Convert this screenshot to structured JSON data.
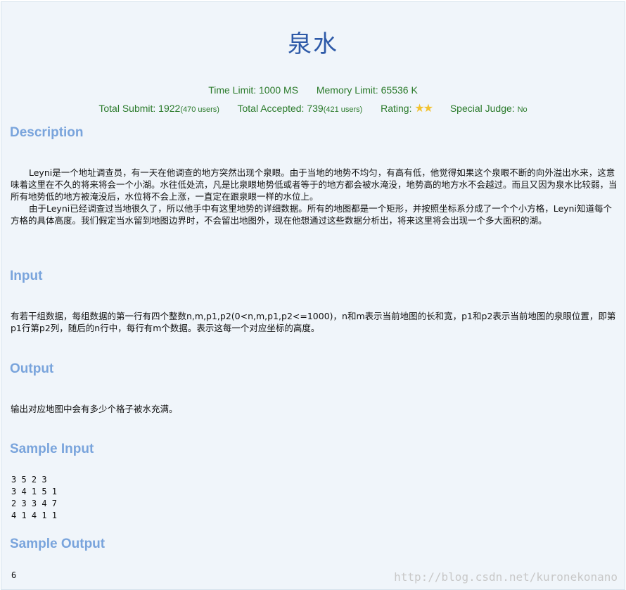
{
  "problem": {
    "title": "泉水",
    "time_limit": "Time Limit: 1000 MS",
    "memory_limit": "Memory Limit: 65536 K",
    "total_submit_label": "Total Submit: 1922",
    "total_submit_users": "(470 users)",
    "total_accepted_label": "Total Accepted: 739",
    "total_accepted_users": "(421 users)",
    "rating_label": "Rating:",
    "rating_stars": "★★",
    "special_judge_label": "Special Judge:",
    "special_judge_value": "No"
  },
  "sections": {
    "description_heading": "Description",
    "description_p1": "Leyni是一个地址调查员，有一天在他调查的地方突然出现个泉眼。由于当地的地势不均匀，有高有低，他觉得如果这个泉眼不断的向外溢出水来，这意味着这里在不久的将来将会一个小湖。水往低处流，凡是比泉眼地势低或者等于的地方都会被水淹没，地势高的地方水不会越过。而且又因为泉水比较弱，当所有地势低的地方被淹没后，水位将不会上涨，一直定在跟泉眼一样的水位上。",
    "description_p2": "由于Leyni已经调查过当地很久了，所以他手中有这里地势的详细数据。所有的地图都是一个矩形，并按照坐标系分成了一个个小方格，Leyni知道每个方格的具体高度。我们假定当水留到地图边界时，不会留出地图外，现在他想通过这些数据分析出，将来这里将会出现一个多大面积的湖。",
    "input_heading": "Input",
    "input_text": "有若干组数据，每组数据的第一行有四个整数n,m,p1,p2(0<n,m,p1,p2<=1000)，n和m表示当前地图的长和宽，p1和p2表示当前地图的泉眼位置，即第p1行第p2列，随后的n行中，每行有m个数据。表示这每一个对应坐标的高度。",
    "output_heading": "Output",
    "output_text": "输出对应地图中会有多少个格子被水充满。",
    "sample_input_heading": "Sample Input",
    "sample_input": "3 5 2 3\n3 4 1 5 1\n2 3 3 4 7\n4 1 4 1 1",
    "sample_output_heading": "Sample Output",
    "sample_output": "6"
  },
  "watermark": "http://blog.csdn.net/kuronekonano",
  "colors": {
    "title": "#2e5aa8",
    "meta_green": "#2a7a2a",
    "heading_blue": "#79a4dc",
    "panel_bg": "#f0f5fa",
    "star": "#f2c230"
  }
}
